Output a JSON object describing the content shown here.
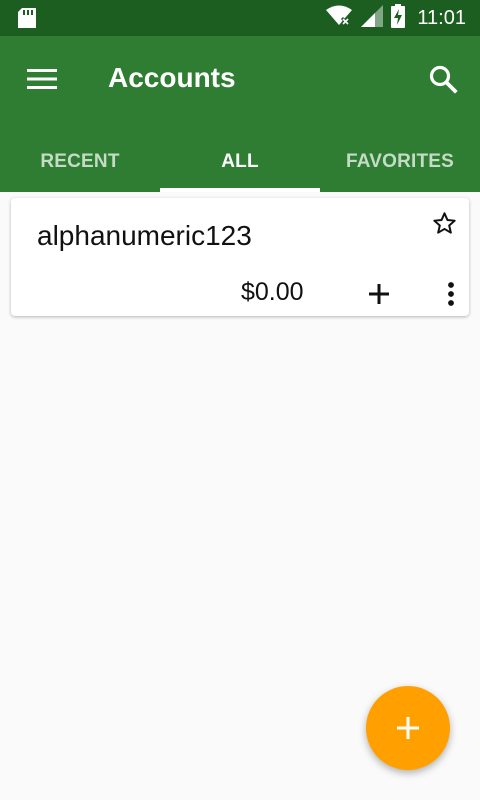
{
  "status_bar": {
    "time": "11:01",
    "icons": [
      "sd-card-icon",
      "wifi-off-icon",
      "signal-icon",
      "battery-charging-icon"
    ]
  },
  "app_bar": {
    "title": "Accounts",
    "menu_icon": "menu-icon",
    "search_icon": "search-icon",
    "color": "#2e7d32"
  },
  "tabs": [
    {
      "label": "RECENT",
      "active": false
    },
    {
      "label": "ALL",
      "active": true
    },
    {
      "label": "FAVORITES",
      "active": false
    }
  ],
  "accounts": [
    {
      "name": "alphanumeric123",
      "balance": "$0.00",
      "favorite": false
    }
  ],
  "fab": {
    "icon": "plus-icon",
    "color": "#ffa000"
  },
  "colors": {
    "status_bar": "#1b5e20",
    "background": "#fafafa"
  }
}
